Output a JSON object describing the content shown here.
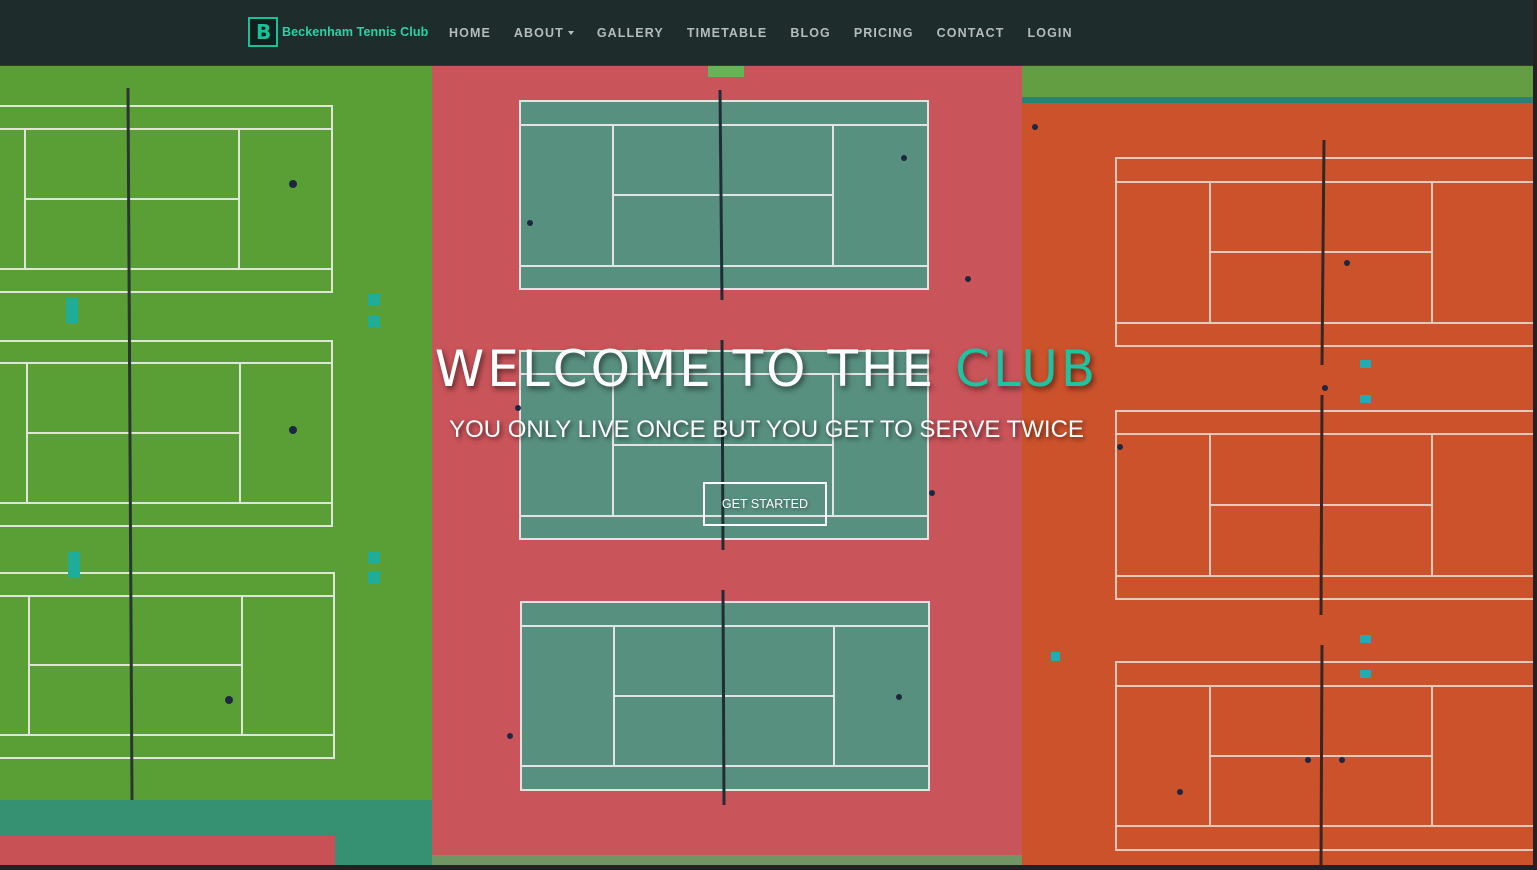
{
  "brand": {
    "logo_letter": "B",
    "name": "Beckenham Tennis Club"
  },
  "nav": {
    "items": [
      {
        "label": "HOME"
      },
      {
        "label": "ABOUT",
        "dropdown": true
      },
      {
        "label": "GALLERY"
      },
      {
        "label": "TIMETABLE"
      },
      {
        "label": "BLOG"
      },
      {
        "label": "PRICING"
      },
      {
        "label": "CONTACT"
      },
      {
        "label": "LOGIN"
      }
    ]
  },
  "hero": {
    "title_main": "WELCOME TO THE ",
    "title_accent": "CLUB",
    "subtitle": "YOU ONLY LIVE ONCE BUT YOU GET TO SERVE TWICE",
    "cta_label": "GET STARTED",
    "background_icon": "aerial-tennis-courts-image"
  },
  "colors": {
    "accent": "#1ec3a1",
    "navbar": "#1f2c2c",
    "grass": "#5fa93a",
    "hard_court_surround": "#d65a60",
    "hard_court_inner": "#5e9a88",
    "clay": "#d9582f"
  }
}
